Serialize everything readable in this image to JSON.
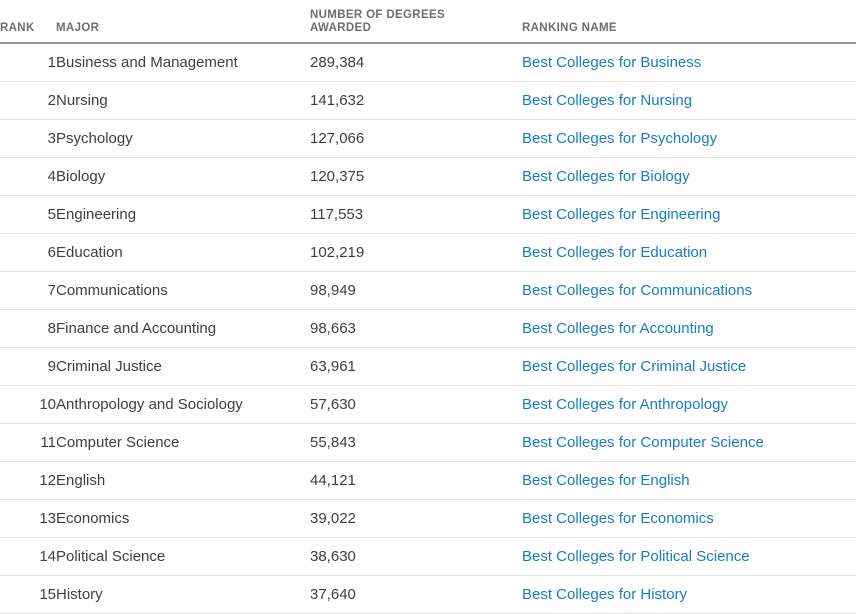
{
  "table": {
    "columns": [
      {
        "key": "rank",
        "label": "RANK"
      },
      {
        "key": "major",
        "label": "MAJOR"
      },
      {
        "key": "degrees",
        "label_line1": "NUMBER OF DEGREES",
        "label_line2": "AWARDED"
      },
      {
        "key": "ranking",
        "label": "RANKING NAME"
      }
    ],
    "link_color": "#1a7cc4",
    "header_text_color": "#706e6b",
    "body_text_color": "#3f3f3f",
    "header_rule_color": "#959595",
    "row_divider_color": "#e2e2e2",
    "rows": [
      {
        "rank": "1",
        "major": "Business and Management",
        "degrees": "289,384",
        "ranking": "Best Colleges for Business"
      },
      {
        "rank": "2",
        "major": "Nursing",
        "degrees": "141,632",
        "ranking": "Best Colleges for Nursing"
      },
      {
        "rank": "3",
        "major": "Psychology",
        "degrees": "127,066",
        "ranking": "Best Colleges for Psychology"
      },
      {
        "rank": "4",
        "major": "Biology",
        "degrees": "120,375",
        "ranking": "Best Colleges for Biology"
      },
      {
        "rank": "5",
        "major": "Engineering",
        "degrees": "117,553",
        "ranking": "Best Colleges for Engineering"
      },
      {
        "rank": "6",
        "major": "Education",
        "degrees": "102,219",
        "ranking": "Best Colleges for Education"
      },
      {
        "rank": "7",
        "major": "Communications",
        "degrees": "98,949",
        "ranking": "Best Colleges for Communications"
      },
      {
        "rank": "8",
        "major": "Finance and Accounting",
        "degrees": "98,663",
        "ranking": "Best Colleges for Accounting"
      },
      {
        "rank": "9",
        "major": "Criminal Justice",
        "degrees": "63,961",
        "ranking": "Best Colleges for Criminal Justice"
      },
      {
        "rank": "10",
        "major": "Anthropology and Sociology",
        "degrees": "57,630",
        "ranking": "Best Colleges for Anthropology"
      },
      {
        "rank": "11",
        "major": "Computer Science",
        "degrees": "55,843",
        "ranking": "Best Colleges for Computer Science"
      },
      {
        "rank": "12",
        "major": "English",
        "degrees": "44,121",
        "ranking": "Best Colleges for English"
      },
      {
        "rank": "13",
        "major": "Economics",
        "degrees": "39,022",
        "ranking": "Best Colleges for Economics"
      },
      {
        "rank": "14",
        "major": "Political Science",
        "degrees": "38,630",
        "ranking": "Best Colleges for Political Science"
      },
      {
        "rank": "15",
        "major": "History",
        "degrees": "37,640",
        "ranking": "Best Colleges for History"
      }
    ]
  }
}
